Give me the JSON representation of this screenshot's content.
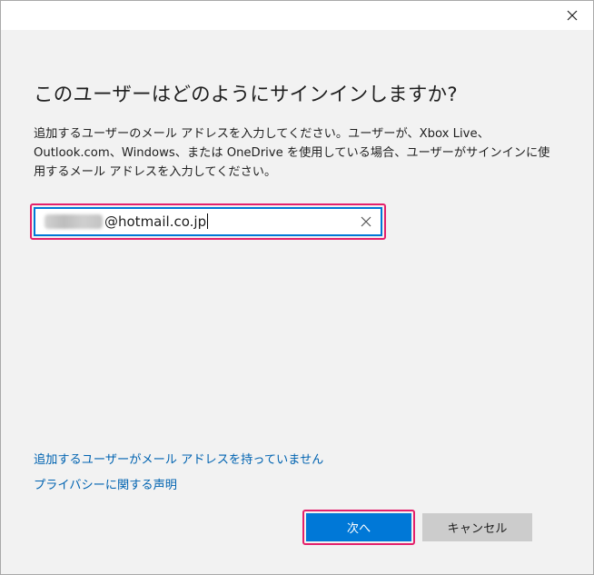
{
  "dialog": {
    "heading": "このユーザーはどのようにサインインしますか?",
    "description": "追加するユーザーのメール アドレスを入力してください。ユーザーが、Xbox Live、Outlook.com、Windows、または OneDrive を使用している場合、ユーザーがサインインに使用するメール アドレスを入力してください。"
  },
  "email": {
    "visible_value": "@hotmail.co.jp"
  },
  "links": {
    "no_email": "追加するユーザーがメール アドレスを持っていません",
    "privacy": "プライバシーに関する声明"
  },
  "buttons": {
    "next_label": "次へ",
    "cancel_label": "キャンセル"
  },
  "icons": {
    "close": "close-icon",
    "clear": "clear-icon"
  },
  "colors": {
    "accent": "#0078d7",
    "highlight": "#e4206b",
    "link": "#0063b1",
    "secondary_button": "#cccccc",
    "background": "#f2f2f2"
  }
}
